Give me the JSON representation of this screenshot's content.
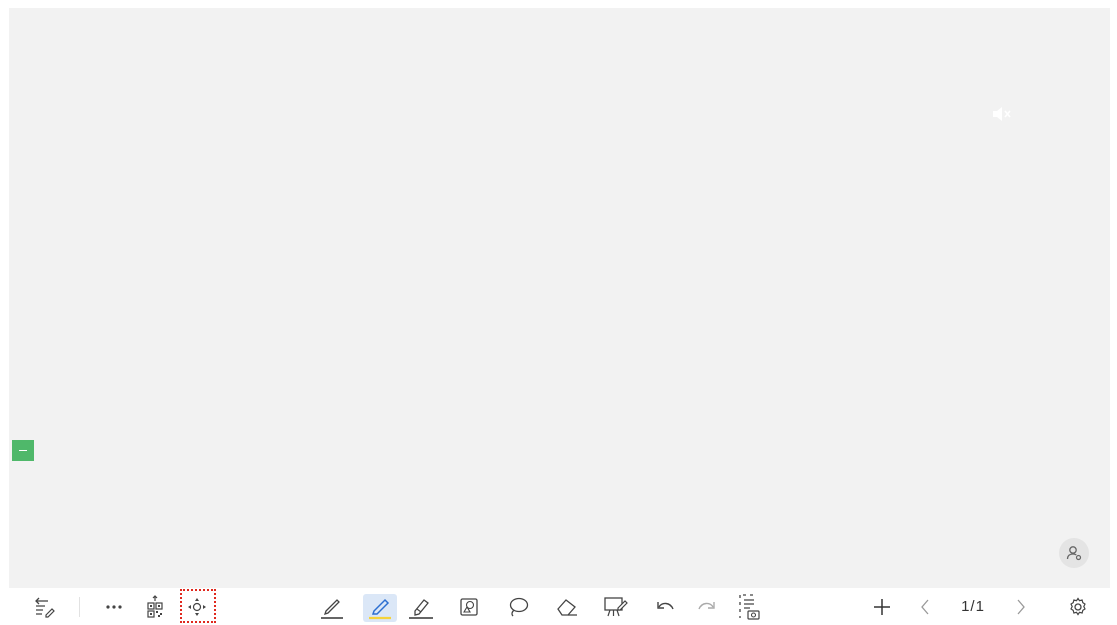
{
  "colors": {
    "canvas": "#f2f2f2",
    "toolbar": "#ffffff",
    "accent_blue": "#2c6fd1",
    "highlight_yellow": "#f5d33b",
    "side_tab_green": "#4fb86a",
    "focus_outline_red": "#e0281e",
    "icon_gray": "#444444"
  },
  "canvas": {
    "mute_icon": "speaker-mute-icon",
    "side_tab_icon": "minus-icon",
    "user_button_icon": "user-group-icon"
  },
  "toolbar": {
    "left": [
      {
        "name": "notes-menu-button",
        "icon": "list-edit-icon"
      },
      {
        "name": "more-options-button",
        "icon": "ellipsis-icon"
      },
      {
        "name": "qr-share-button",
        "icon": "qr-code-icon"
      },
      {
        "name": "move-toolbar-button",
        "icon": "move-arrows-icon"
      }
    ],
    "center": [
      {
        "name": "pen-button",
        "icon": "pen-icon"
      },
      {
        "name": "highlighter-button",
        "icon": "highlighter-icon",
        "active": true
      },
      {
        "name": "brush-button",
        "icon": "brush-icon"
      },
      {
        "name": "shapes-button",
        "icon": "shapes-icon"
      },
      {
        "name": "lasso-button",
        "icon": "lasso-icon"
      },
      {
        "name": "eraser-button",
        "icon": "eraser-icon"
      },
      {
        "name": "background-button",
        "icon": "easel-icon"
      },
      {
        "name": "undo-button",
        "icon": "undo-icon"
      },
      {
        "name": "redo-button",
        "icon": "redo-icon"
      },
      {
        "name": "screenshot-button",
        "icon": "screenshot-icon"
      }
    ],
    "right": [
      {
        "name": "add-page-button",
        "icon": "plus-icon"
      },
      {
        "name": "prev-page-button",
        "icon": "chevron-left-icon"
      },
      {
        "name": "next-page-button",
        "icon": "chevron-right-icon"
      },
      {
        "name": "settings-button",
        "icon": "gear-icon"
      }
    ],
    "page_indicator": "1/1"
  }
}
